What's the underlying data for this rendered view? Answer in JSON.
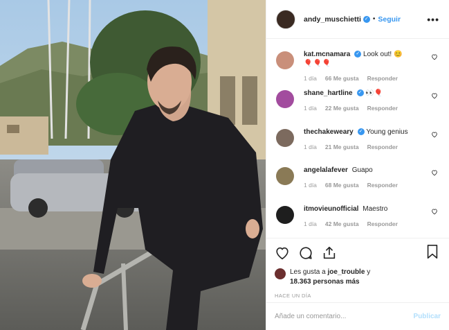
{
  "header": {
    "username": "andy_muschietti",
    "follow_label": "Seguir",
    "dot": "•",
    "more_label": "•••"
  },
  "comments": [
    {
      "user": "kat.mcnamara",
      "verified": true,
      "text": "Look out! 😊",
      "extra": "🎈🎈🎈",
      "time": "1 día",
      "likes": "66 Me gusta",
      "reply": "Responder",
      "avatar_color": "#c98f7a"
    },
    {
      "user": "shane_hartline",
      "verified": true,
      "text": "👀🎈",
      "extra": "",
      "time": "1 día",
      "likes": "22 Me gusta",
      "reply": "Responder",
      "avatar_color": "#a24c9e"
    },
    {
      "user": "thechakeweary",
      "verified": true,
      "text": "Young genius",
      "extra": "",
      "time": "1 día",
      "likes": "21 Me gusta",
      "reply": "Responder",
      "avatar_color": "#7c6a5e"
    },
    {
      "user": "angelalafever",
      "verified": false,
      "text": "Guapo",
      "extra": "",
      "time": "1 día",
      "likes": "68 Me gusta",
      "reply": "Responder",
      "avatar_color": "#8a7a56"
    },
    {
      "user": "itmovieunofficial",
      "verified": false,
      "text": "Maestro",
      "extra": "",
      "time": "1 día",
      "likes": "42 Me gusta",
      "reply": "Responder",
      "avatar_color": "#1e1e1e"
    }
  ],
  "likes": {
    "prefix": "Les gusta a",
    "user": "joe_trouble",
    "connector": "y",
    "others": "18.363 personas más"
  },
  "time_ago": "HACE UN DÍA",
  "add_comment": {
    "placeholder": "Añade un comentario...",
    "publish_label": "Publicar"
  },
  "colors": {
    "accent": "#3897f0",
    "publish_disabled": "#b2dffc",
    "meta_text": "#999999"
  },
  "icons": [
    "heart-icon",
    "comment-icon",
    "share-icon",
    "bookmark-icon",
    "verified-icon",
    "more-options-icon"
  ]
}
